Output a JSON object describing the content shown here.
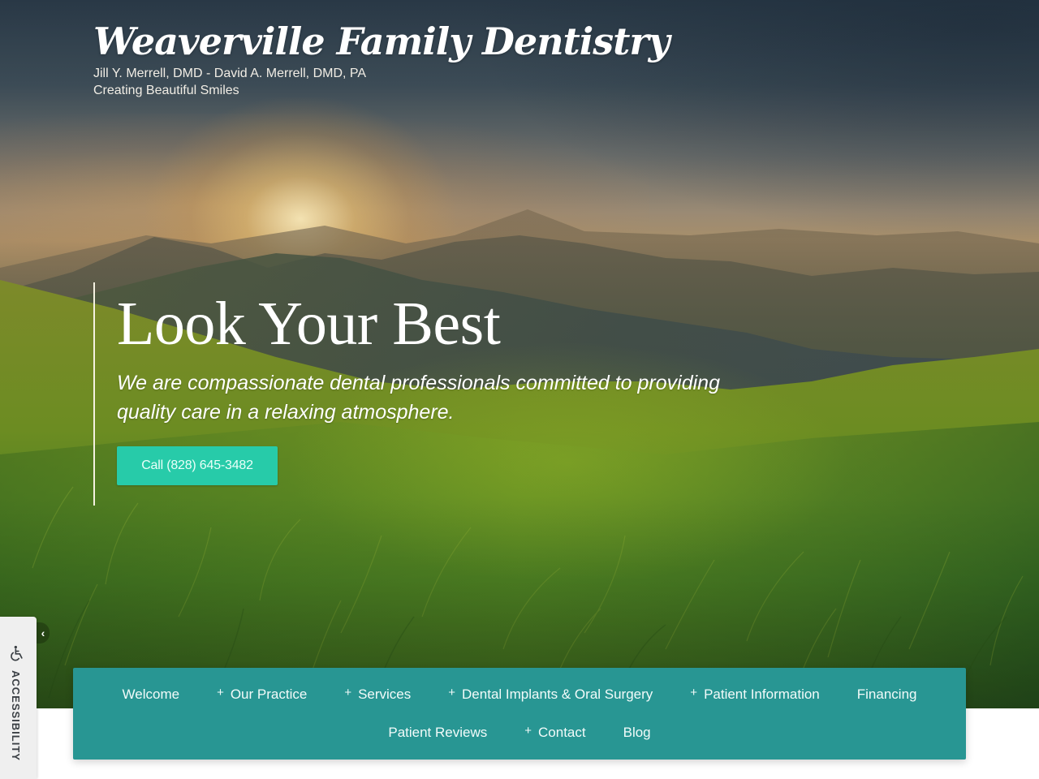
{
  "header": {
    "site_title": "Weaverville Family Dentistry",
    "doctors": "Jill Y. Merrell, DMD - David A. Merrell, DMD, PA",
    "slogan": "Creating Beautiful Smiles"
  },
  "hero": {
    "headline": "Look Your Best",
    "tagline": "We are compassionate dental professionals committed to providing quality care in a relaxing atmosphere.",
    "cta_label": "Call (828) 645-3482"
  },
  "accessibility": {
    "label": "ACCESSIBILITY",
    "icon": "wheelchair-icon",
    "toggle_icon": "chevron-left-icon"
  },
  "nav": {
    "row1": [
      {
        "label": "Welcome",
        "has_submenu": false
      },
      {
        "label": "Our Practice",
        "has_submenu": true
      },
      {
        "label": "Services",
        "has_submenu": true
      },
      {
        "label": "Dental Implants & Oral Surgery",
        "has_submenu": true
      },
      {
        "label": "Patient Information",
        "has_submenu": true
      },
      {
        "label": "Financing",
        "has_submenu": false
      }
    ],
    "row2": [
      {
        "label": "Patient Reviews",
        "has_submenu": false
      },
      {
        "label": "Contact",
        "has_submenu": true
      },
      {
        "label": "Blog",
        "has_submenu": false
      }
    ],
    "submenu_marker": "+"
  },
  "colors": {
    "nav_bg": "#289693",
    "cta_bg": "#27cba9",
    "accessibility_tab_bg": "#efefef"
  }
}
